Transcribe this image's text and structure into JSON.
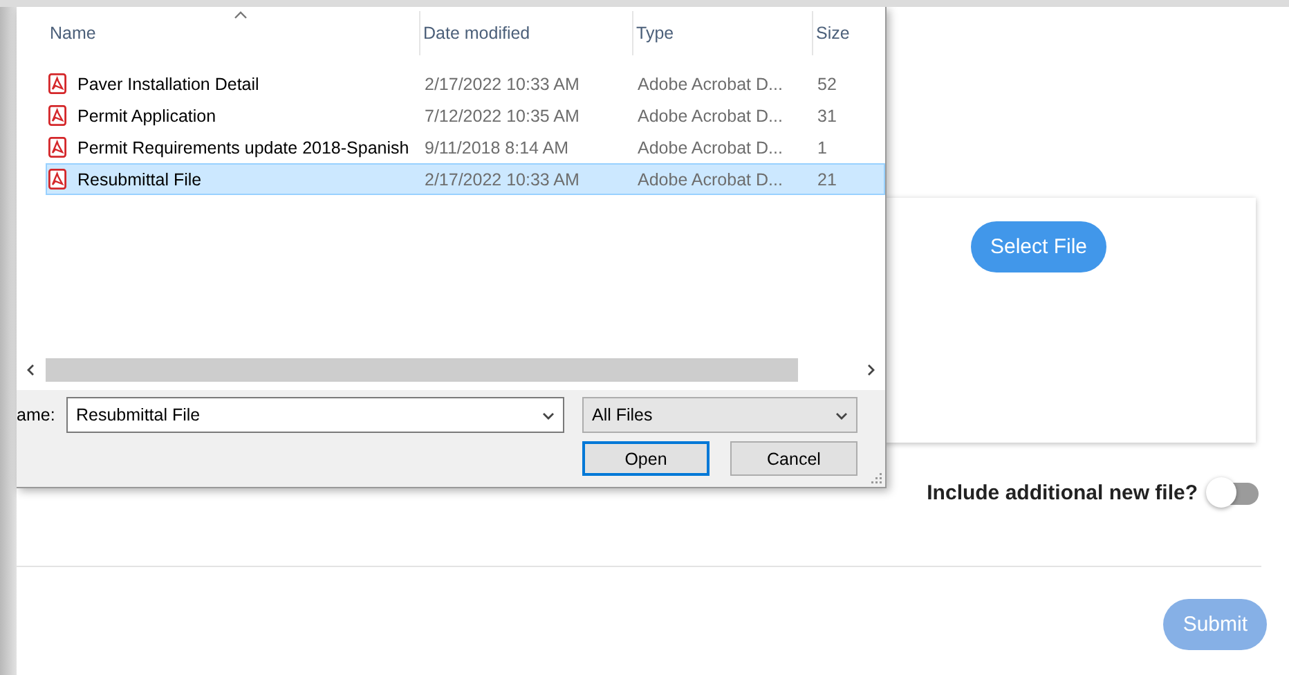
{
  "dialog": {
    "columns": [
      {
        "label": "Name",
        "sorted": true
      },
      {
        "label": "Date modified",
        "sorted": false
      },
      {
        "label": "Type",
        "sorted": false
      },
      {
        "label": "Size",
        "sorted": false
      }
    ],
    "files": [
      {
        "name": "Paver Installation Detail",
        "date": "2/17/2022 10:33 AM",
        "type": "Adobe Acrobat D...",
        "size": "52",
        "selected": false
      },
      {
        "name": "Permit Application",
        "date": "7/12/2022 10:35 AM",
        "type": "Adobe Acrobat D...",
        "size": "31",
        "selected": false
      },
      {
        "name": "Permit Requirements update 2018-Spanish",
        "date": "9/11/2018 8:14 AM",
        "type": "Adobe Acrobat D...",
        "size": "1",
        "selected": false
      },
      {
        "name": "Resubmittal File",
        "date": "2/17/2022 10:33 AM",
        "type": "Adobe Acrobat D...",
        "size": "21",
        "selected": true
      }
    ],
    "filename_label": "ame:",
    "filename": "Resubmittal File",
    "filter": "All Files",
    "buttons": [
      {
        "label": "Open",
        "default": true
      },
      {
        "label": "Cancel",
        "default": false
      }
    ]
  },
  "form": {
    "select_button": "Select File",
    "toggle": {
      "label": "Include additional new file?",
      "on": false
    },
    "submit": {
      "label": "Submit",
      "disabled": true
    }
  }
}
